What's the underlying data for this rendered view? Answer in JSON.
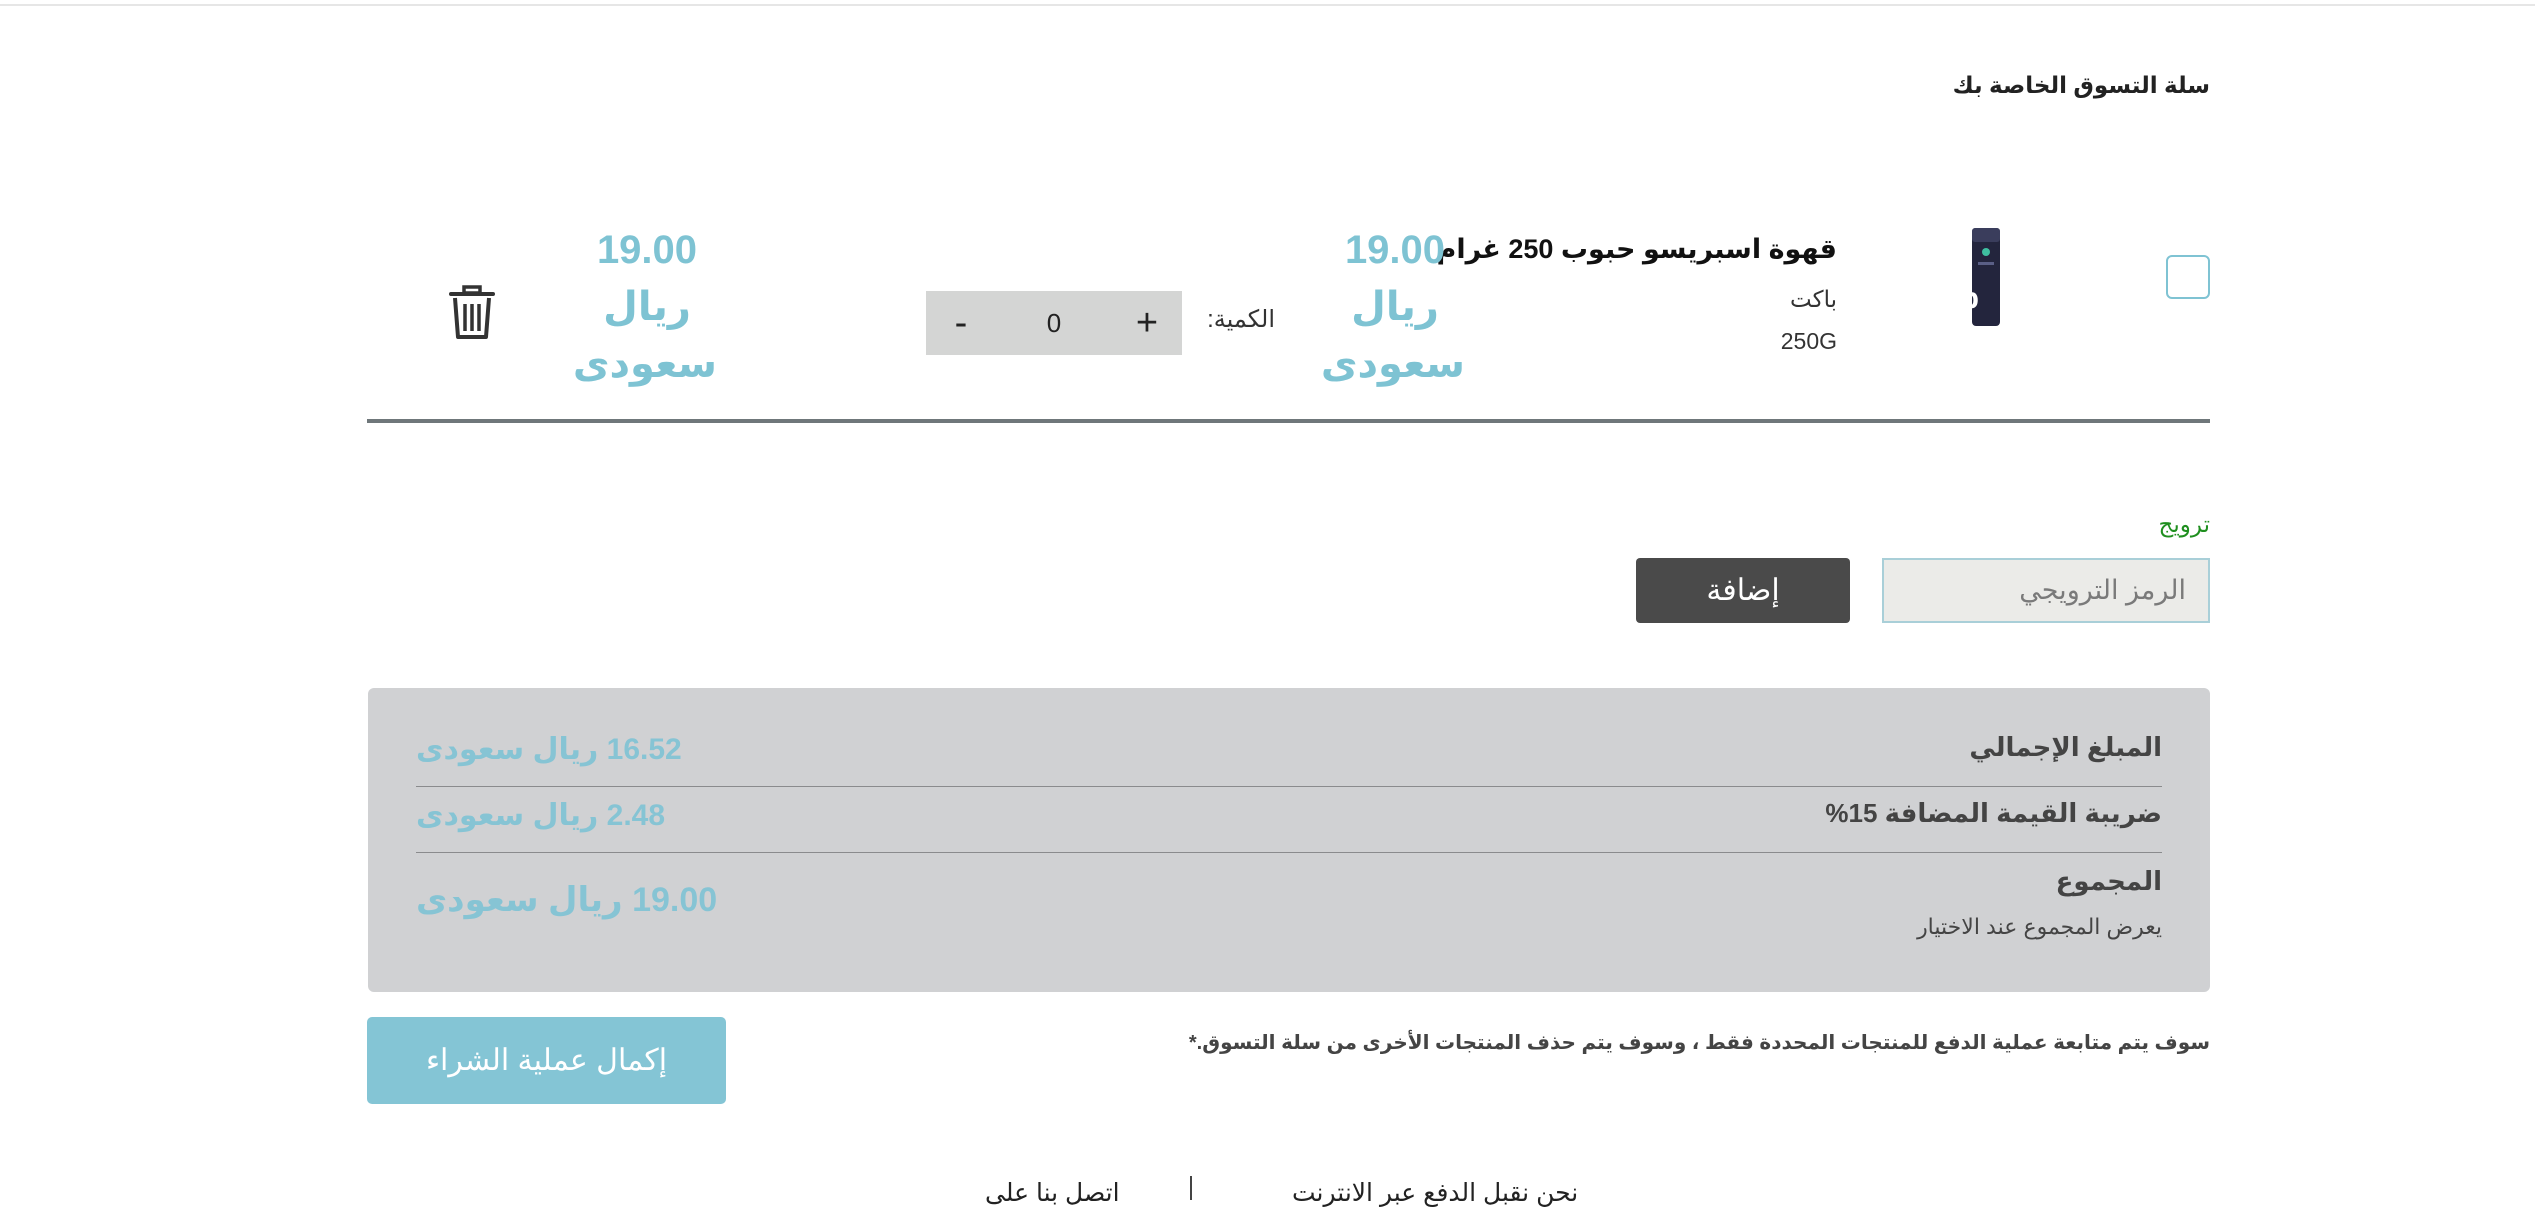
{
  "cart": {
    "title": "سلة التسوق الخاصة بك",
    "items": [
      {
        "name": "قهوة اسبريسو حبوب 250 غرام",
        "brand": "باكت",
        "size": "250G",
        "unit_price": "19.00",
        "total_price": "19.00",
        "currency_line1": "ريال",
        "currency_line2": "سعودى",
        "quantity_label": "الكمية:",
        "quantity": "0",
        "plus": "+",
        "minus": "-"
      }
    ]
  },
  "promo": {
    "label": "ترويج",
    "placeholder": "الرمز الترويجي",
    "button": "إضافة"
  },
  "summary": {
    "subtotal_label": "المبلغ الإجمالي",
    "subtotal_value": "16.52 ريال سعودى",
    "vat_label": "ضريبة القيمة المضافة 15%",
    "vat_value": "2.48 ريال سعودى",
    "total_label": "المجموع",
    "total_note": "يعرض المجموع عند الاختيار",
    "total_value": "19.00 ريال سعودى"
  },
  "checkout": {
    "note": "سوف يتم متابعة عملية الدفع للمنتجات المحددة فقط ، وسوف يتم حذف المنتجات الأخرى من سلة التسوق.*",
    "button": "إكمال عملية الشراء"
  },
  "footer": {
    "payment_text": "نحن نقبل الدفع عبر الانترنت",
    "contact_text": "اتصل بنا على"
  },
  "colors": {
    "accent": "#7ec3d3",
    "promo_label": "#1f8f1f",
    "dark_button": "#4a4a4a",
    "summary_bg": "#d0d1d3"
  }
}
